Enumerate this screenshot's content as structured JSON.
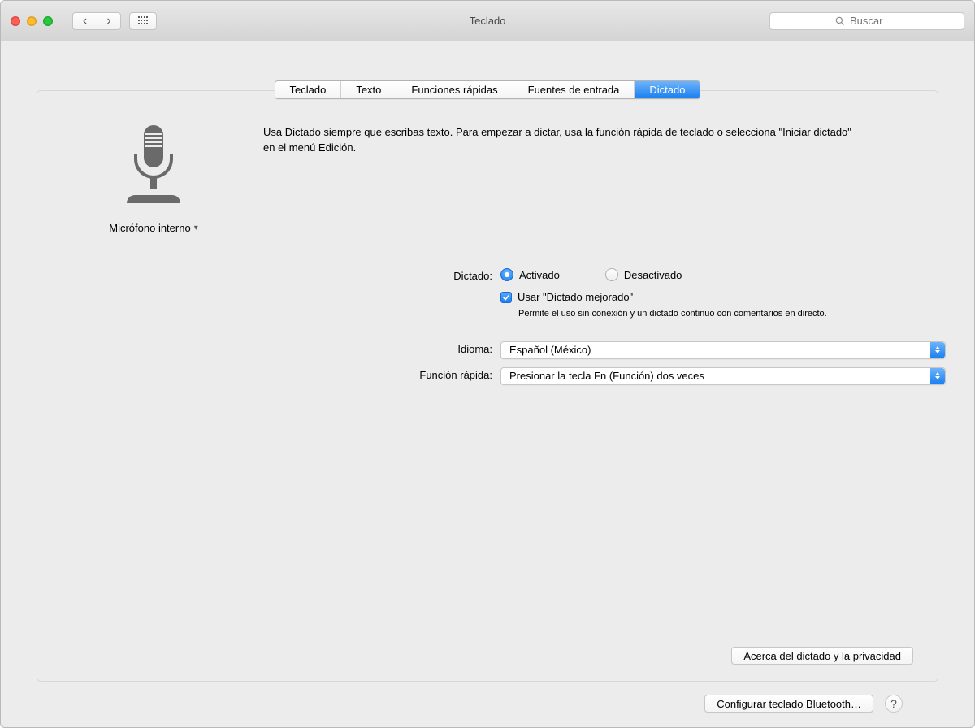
{
  "window": {
    "title": "Teclado",
    "search_placeholder": "Buscar"
  },
  "tabs": [
    {
      "label": "Teclado"
    },
    {
      "label": "Texto"
    },
    {
      "label": "Funciones rápidas"
    },
    {
      "label": "Fuentes de entrada"
    },
    {
      "label": "Dictado"
    }
  ],
  "active_tab_index": 4,
  "microphone": {
    "label": "Micrófono interno"
  },
  "description": "Usa Dictado siempre que escribas texto. Para empezar a dictar, usa la función rápida de teclado o selecciona \"Iniciar dictado\" en el menú Edición.",
  "dictation": {
    "label": "Dictado:",
    "on_label": "Activado",
    "off_label": "Desactivado",
    "value": "on",
    "enhanced_label": "Usar \"Dictado mejorado\"",
    "enhanced_checked": true,
    "enhanced_helper": "Permite el uso sin conexión y un dictado continuo con comentarios en directo."
  },
  "language": {
    "label": "Idioma:",
    "value": "Español (México)"
  },
  "shortcut": {
    "label": "Función rápida:",
    "value": "Presionar la tecla Fn (Función) dos veces"
  },
  "buttons": {
    "about_privacy": "Acerca del dictado y la privacidad",
    "bluetooth": "Configurar teclado Bluetooth…",
    "help": "?"
  }
}
